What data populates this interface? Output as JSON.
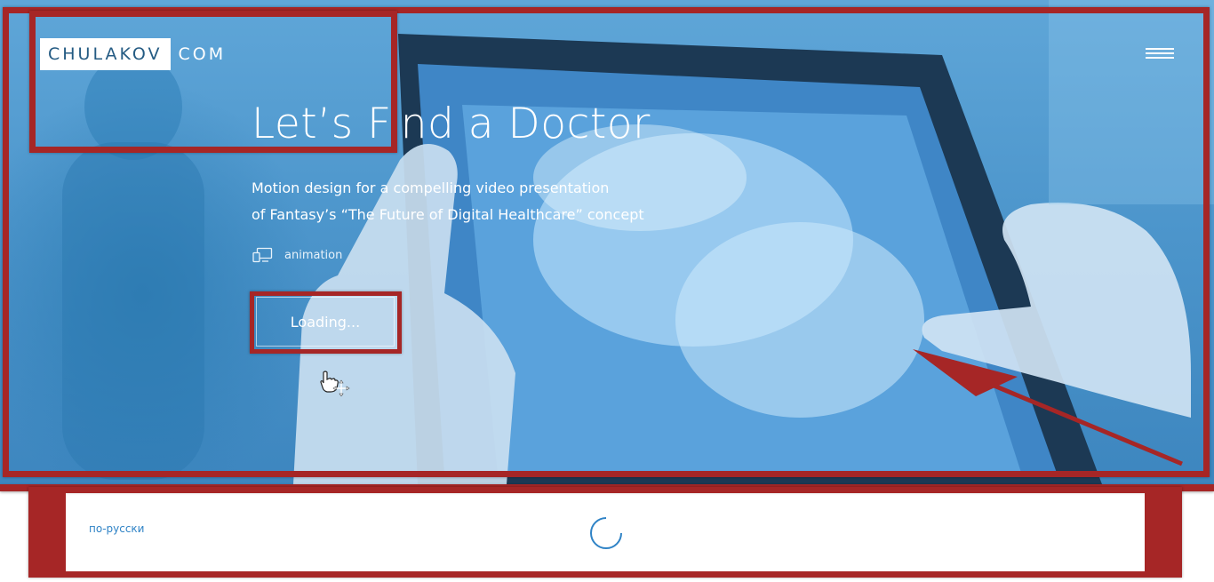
{
  "brand": {
    "logo_box_text": "CHULAKOV",
    "logo_suffix_text": "COM"
  },
  "hero": {
    "title": "Let’s Find a Doctor",
    "description_line1": "Motion design for a compelling video presentation",
    "description_line2": "of Fantasy’s “The Future of Digital Healthcare” concept",
    "category_icon": "devices-icon",
    "category_label": "animation",
    "button_label": "Loading..."
  },
  "nav": {
    "menu_icon": "hamburger-menu-icon"
  },
  "footer": {
    "language_link": "по-русски",
    "spinner_icon": "loading-spinner-icon",
    "grid_icon": "grid-icon"
  },
  "colors": {
    "hero_overlay": "#4d96cc",
    "annotation_red": "#a62626",
    "link_blue": "#2f83c6",
    "logo_text": "#245b83"
  }
}
